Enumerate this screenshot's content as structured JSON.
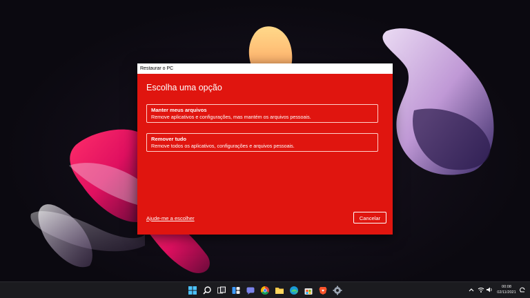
{
  "dialog": {
    "window_title": "Restaurar o PC",
    "heading": "Escolha uma opção",
    "options": [
      {
        "title": "Manter meus arquivos",
        "description": "Remove aplicativos e configurações, mas mantém os arquivos pessoais."
      },
      {
        "title": "Remover tudo",
        "description": "Remove todos os aplicativos, configurações e arquivos pessoais."
      }
    ],
    "help_link": "Ajude-me a escolher",
    "cancel_label": "Cancelar"
  },
  "taskbar": {
    "icons": [
      "start-icon",
      "search-icon",
      "task-view-icon",
      "widgets-icon",
      "chat-icon",
      "file-explorer-icon",
      "chrome-icon",
      "edge-icon",
      "store-icon",
      "brave-icon",
      "settings-icon"
    ],
    "tray_icons": [
      "chevron-up-icon",
      "wifi-icon",
      "volume-icon",
      "notification-icon"
    ],
    "time": "00:08",
    "date": "02/11/2021"
  },
  "colors": {
    "dialog_background": "#e0150f",
    "taskbar_background": "#1b1b1f",
    "desktop_background": "#0c0a12"
  }
}
